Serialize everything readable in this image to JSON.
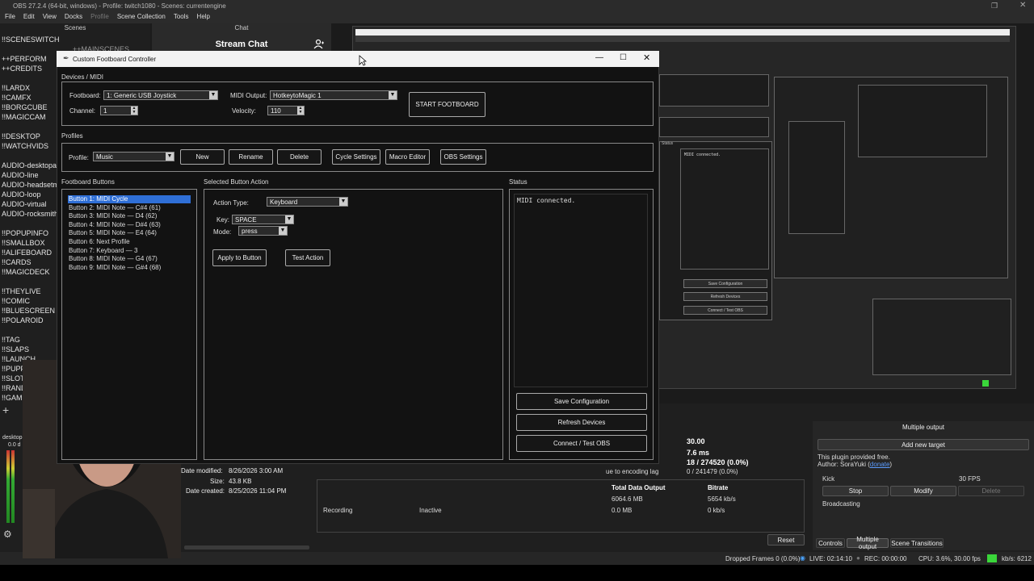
{
  "obs": {
    "title": "OBS 27.2.4 (64-bit, windows) - Profile: twitch1080 - Scenes: currentengine",
    "menu": [
      "File",
      "Edit",
      "View",
      "Docks",
      "Profile",
      "Scene Collection",
      "Tools",
      "Help"
    ],
    "scenes_header": "Scenes",
    "chat_header": "Chat",
    "chat_title": "Stream Chat",
    "scenes": [
      "!!SCENESWITCH",
      "++MAINSCENES",
      "++PERFORM",
      "++CREDITS",
      "!!LARDX",
      "!!CAMFX",
      "!!BORGCUBE",
      "!!MAGICCAM",
      "!!DESKTOP",
      "!!WATCHVIDS",
      "AUDIO-desktopa",
      "AUDIO-line",
      "AUDIO-headsetm",
      "AUDIO-loop",
      "AUDIO-virtual",
      "AUDIO-rocksmith",
      "!!POPUPINFO",
      "!!SMALLBOX",
      "!!ALIFEBOARD",
      "!!CARDS",
      "!!MAGICDECK",
      "!!THEYLIVE",
      "!!COMIC",
      "!!BLUESCREEN",
      "!!POLAROID",
      "!!TAG",
      "!!SLAPS",
      "!!LAUNCH",
      "!!PUPP",
      "!!SLOT",
      "!!RAND",
      "!!GAME"
    ],
    "file_info": {
      "date_modified_label": "Date modified:",
      "date_modified": "8/26/2026 3:00 AM",
      "size_label": "Size:",
      "size": "43.8 KB",
      "date_created_label": "Date created:",
      "date_created": "8/25/2026 11:04 PM"
    },
    "stats": {
      "fps": "30.00",
      "ms": "7.6 ms",
      "frames1": "18 / 274520 (0.0%)",
      "frames2": "0 / 241479 (0.0%)",
      "encoding_lag": "ue to encoding lag",
      "total_data_label": "Total Data Output",
      "bitrate_label": "Bitrate",
      "stream_data": "6064.6 MB",
      "stream_bitrate": "5654 kb/s",
      "recording_label": "Recording",
      "recording_status": "Inactive",
      "rec_data": "0.0 MB",
      "rec_bitrate": "0 kb/s",
      "reset": "Reset"
    },
    "multi_output": {
      "header": "Multiple output",
      "add_target": "Add new target",
      "plugin_note": "This plugin provided free.",
      "author_prefix": "Author: SoraYuki (",
      "donate": "donate",
      "author_suffix": ")",
      "target_name": "Kick",
      "target_fps": "30 FPS",
      "stop": "Stop",
      "modify": "Modify",
      "delete": "Delete",
      "status": "Broadcasting",
      "tabs": [
        "Controls",
        "Multiple output",
        "Scene Transitions"
      ]
    },
    "statusbar": {
      "dropped": "Dropped Frames 0 (0.0%)",
      "live": "LIVE: 02:14:10",
      "rec": "REC: 00:00:00",
      "cpu": "CPU: 3.6%, 30.00 fps",
      "kbs": "kb/s: 6212"
    },
    "mixer_label": "desktop",
    "mixer_value": "0.0 d"
  },
  "dialog": {
    "title": "Custom Footboard Controller",
    "devices_section": "Devices / MIDI",
    "footboard_label": "Footboard:",
    "footboard_value": "1: Generic USB Joystick",
    "midi_output_label": "MIDI Output:",
    "midi_output_value": "HotkeytoMagic 1",
    "channel_label": "Channel:",
    "channel_value": "1",
    "velocity_label": "Velocity:",
    "velocity_value": "110",
    "start_button": "START FOOTBOARD",
    "profiles_section": "Profiles",
    "profile_label": "Profile:",
    "profile_value": "Music",
    "profile_buttons": [
      "New",
      "Rename",
      "Delete",
      "Cycle Settings",
      "Macro Editor",
      "OBS Settings"
    ],
    "buttons_section": "Footboard Buttons",
    "buttons": [
      "Button 1: MIDI Cycle",
      "Button 2: MIDI Note — C#4 (61)",
      "Button 3: MIDI Note — D4 (62)",
      "Button 4: MIDI Note — D#4 (63)",
      "Button 5: MIDI Note — E4 (64)",
      "Button 6: Next Profile",
      "Button 7: Keyboard — 3",
      "Button 8: MIDI Note — G4 (67)",
      "Button 9: MIDI Note — G#4 (68)"
    ],
    "action_section": "Selected Button Action",
    "action_type_label": "Action Type:",
    "action_type_value": "Keyboard",
    "key_label": "Key:",
    "key_value": "SPACE",
    "mode_label": "Mode:",
    "mode_value": "press",
    "apply_button": "Apply to Button",
    "test_button": "Test Action",
    "status_section": "Status",
    "status_text": "MIDI connected.",
    "save_config": "Save Configuration",
    "refresh_devices": "Refresh Devices",
    "connect_obs": "Connect / Test OBS"
  },
  "nested": {
    "status_label": "Status",
    "status_text": "MIDI connected.",
    "save_config": "Save Configuration",
    "refresh_devices": "Refresh Devices",
    "connect_obs": "Connect / Test OBS",
    "title": "OBS 27.2.4 (64-bit, windows) - Profile: twitch1080 - Scenes: currentengine"
  },
  "colors": {
    "selection": "#2f6fd6",
    "live_indicator": "#3ad63a"
  }
}
